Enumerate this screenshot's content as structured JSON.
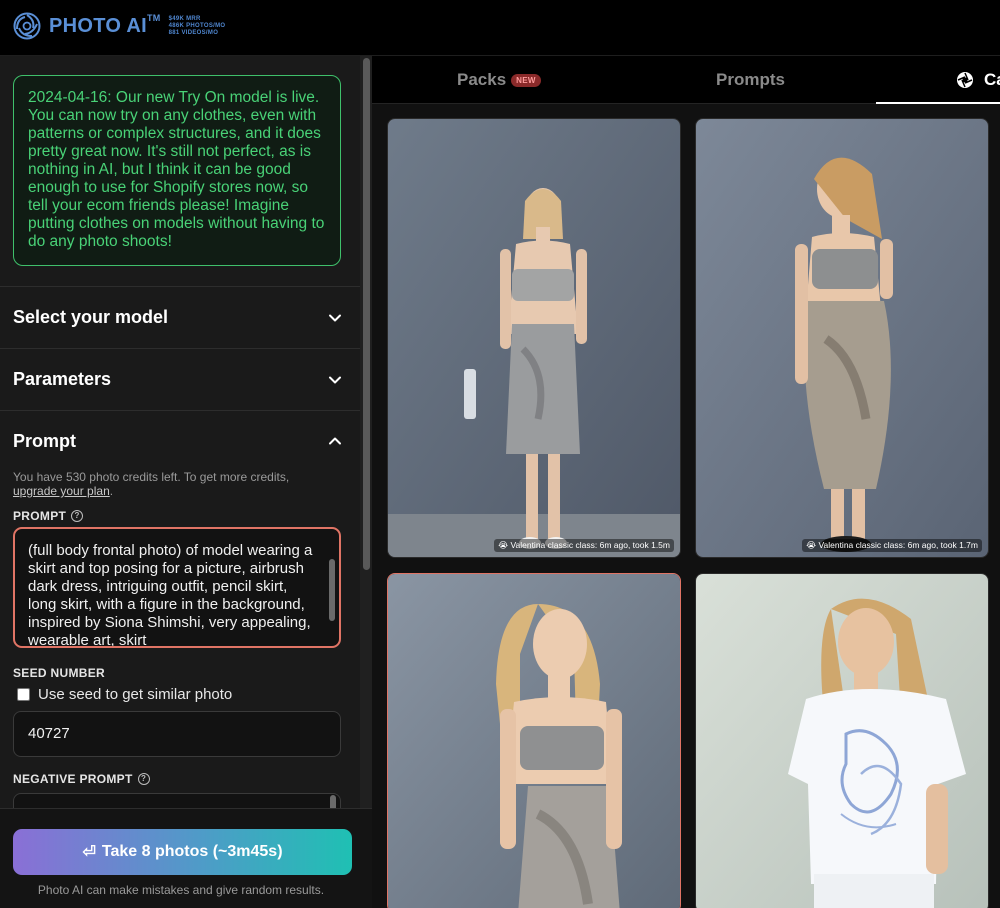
{
  "header": {
    "brand": "PHOTO AI",
    "trademark": "TM",
    "stats": [
      "$49K MRR",
      "486K PHOTOS/MO",
      "881 VIDEOS/MO"
    ]
  },
  "notice": {
    "text": "2024-04-16: Our new Try On model is live. You can now try on any clothes, even with patterns or complex structures, and it does pretty great now. It's still not perfect, as is nothing in AI, but I think it can be good enough to use for Shopify stores now, so tell your ecom friends please! Imagine putting clothes on models without having to do any photo shoots!"
  },
  "sections": {
    "model": "Select your model",
    "parameters": "Parameters",
    "prompt": "Prompt"
  },
  "credits": {
    "text": "You have 530 photo credits left. To get more credits,",
    "link": "upgrade your plan",
    "suffix": "."
  },
  "prompt": {
    "label": "PROMPT",
    "value": "(full body frontal photo) of model wearing a skirt and top posing for a picture, airbrush dark dress, intriguing outfit, pencil skirt, long skirt, with a figure in the background, inspired by Siona Shimshi, very appealing, wearable art, skirt"
  },
  "seed": {
    "label": "SEED NUMBER",
    "checkbox_label": "Use seed to get similar photo",
    "value": "40727"
  },
  "negative": {
    "label": "NEGATIVE PROMPT"
  },
  "action": {
    "button": "Take 8 photos (~3m45s)",
    "disclaimer": "Photo AI can make mistakes and give random results."
  },
  "tabs": {
    "packs": "Packs",
    "packs_badge": "NEW",
    "prompts": "Prompts",
    "camera": "Ca"
  },
  "photos": [
    {
      "caption": "😭 Valentina classic class: 6m ago, took 1.5m"
    },
    {
      "caption": "😭 Valentina classic class: 6m ago, took 1.7m"
    }
  ],
  "colors": {
    "accent_green": "#49d277",
    "accent_coral": "#e07465",
    "brand_blue": "#5a8fd6"
  }
}
